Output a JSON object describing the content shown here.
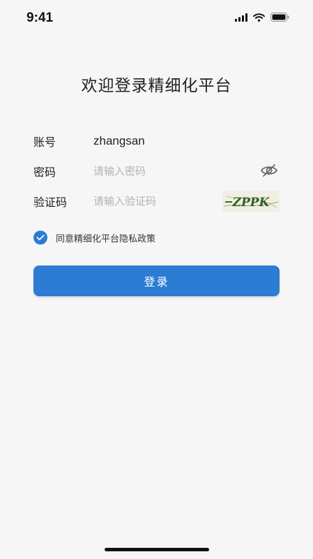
{
  "status_bar": {
    "time": "9:41"
  },
  "title": "欢迎登录精细化平台",
  "form": {
    "account": {
      "label": "账号",
      "value": "zhangsan"
    },
    "password": {
      "label": "密码",
      "placeholder": "请输入密码"
    },
    "captcha": {
      "label": "验证码",
      "placeholder": "请输入验证码",
      "image_text": "ZPPK"
    }
  },
  "agreement": {
    "text": "同意精细化平台隐私政策",
    "checked": true
  },
  "login_button": {
    "label": "登录"
  },
  "colors": {
    "primary": "#2c7cd4",
    "background": "#f6f6f6"
  },
  "icons": [
    "signal-icon",
    "wifi-icon",
    "battery-icon",
    "eye-hidden-icon",
    "check-icon"
  ]
}
